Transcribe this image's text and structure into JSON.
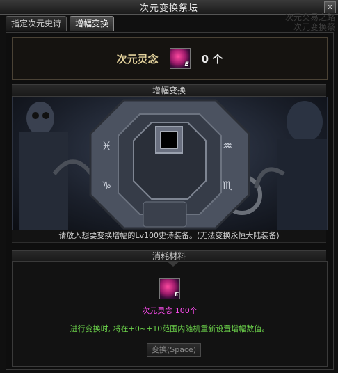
{
  "window": {
    "title": "次元变换祭坛",
    "close_label": "x"
  },
  "background_text": {
    "line1": "次元交易之路",
    "line2": "次元变换祭"
  },
  "tabs": [
    {
      "label": "指定次元史诗",
      "active": false
    },
    {
      "label": "增幅变换",
      "active": true
    }
  ],
  "currency": {
    "name": "次元灵念",
    "count": "0 个",
    "icon": "dimension-essence-icon",
    "icon_badge": "E"
  },
  "transform": {
    "header": "增幅变换",
    "instruction": "请放入想要变换增幅的Lv100史诗装备。(无法变换永恒大陆装备)"
  },
  "materials": {
    "header": "消耗材料",
    "item_text": "次元灵念 100个",
    "icon_badge": "E",
    "description": "进行变换时, 将在+0~+10范围内随机重新设置增幅数值。",
    "button_label": "变换(Space)"
  },
  "colors": {
    "accent_gold": "#e0cf9a",
    "material_pink": "#ff4cf0",
    "desc_green": "#6bd14a"
  }
}
